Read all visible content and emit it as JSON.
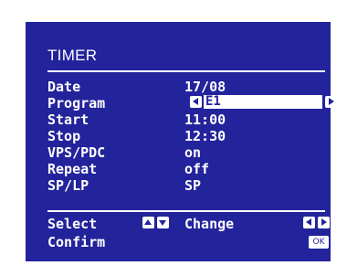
{
  "window": {
    "title": "TIMER"
  },
  "rows": [
    {
      "label": "Date",
      "value": "17/08"
    },
    {
      "label": "Program",
      "value": "E1"
    },
    {
      "label": "Start",
      "value": "11:00"
    },
    {
      "label": "Stop",
      "value": "12:30"
    },
    {
      "label": "VPS/PDC",
      "value": "on"
    },
    {
      "label": "Repeat",
      "value": "off"
    },
    {
      "label": "SP/LP",
      "value": "SP"
    }
  ],
  "footer": {
    "select_label": "Select",
    "change_label": "Change",
    "confirm_label": "Confirm",
    "ok_label": "OK"
  },
  "icons": {
    "select": [
      "arrow-up-icon",
      "arrow-down-icon"
    ],
    "change": [
      "arrow-left-icon",
      "arrow-right-icon"
    ],
    "program": [
      "arrow-left-icon",
      "arrow-right-icon"
    ]
  },
  "colors": {
    "background": "#23239c",
    "foreground": "#ffffff"
  }
}
